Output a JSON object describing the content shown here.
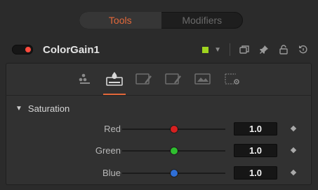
{
  "top_tabs": [
    {
      "label": "Tools",
      "active": true
    },
    {
      "label": "Modifiers",
      "active": false
    }
  ],
  "tool": {
    "name": "ColorGain1",
    "enabled": true,
    "color_swatch": "#9fd41f",
    "header_icons": [
      "chevron-down-icon",
      "duplicate-icon",
      "pin-icon",
      "lock-icon",
      "reset-icon"
    ]
  },
  "panel_tabs": [
    {
      "icon": "controls-nodes-icon",
      "active": false
    },
    {
      "icon": "color-gain-icon",
      "active": true
    },
    {
      "icon": "pencil-settings-icon",
      "active": false
    },
    {
      "icon": "pencil-settings-icon-2",
      "active": false
    },
    {
      "icon": "image-icon",
      "active": false
    },
    {
      "icon": "settings-gear-icon",
      "active": false
    }
  ],
  "section": {
    "title": "Saturation",
    "expanded": true
  },
  "sliders": [
    {
      "label": "Red",
      "value": "1.0",
      "fraction": 0.5,
      "color": "#d62020"
    },
    {
      "label": "Green",
      "value": "1.0",
      "fraction": 0.5,
      "color": "#2fbf2f"
    },
    {
      "label": "Blue",
      "value": "1.0",
      "fraction": 0.5,
      "color": "#2f6fd6"
    }
  ],
  "accent_color": "#e3683a"
}
